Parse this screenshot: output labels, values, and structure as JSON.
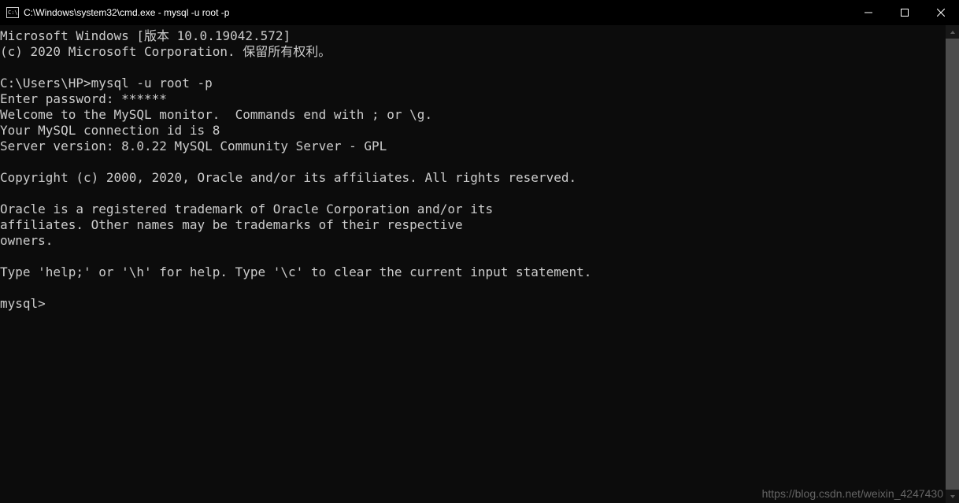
{
  "titlebar": {
    "title": "C:\\Windows\\system32\\cmd.exe - mysql  -u root -p"
  },
  "terminal": {
    "lines": [
      "Microsoft Windows [版本 10.0.19042.572]",
      "(c) 2020 Microsoft Corporation. 保留所有权利。",
      "",
      "C:\\Users\\HP>mysql -u root -p",
      "Enter password: ******",
      "Welcome to the MySQL monitor.  Commands end with ; or \\g.",
      "Your MySQL connection id is 8",
      "Server version: 8.0.22 MySQL Community Server - GPL",
      "",
      "Copyright (c) 2000, 2020, Oracle and/or its affiliates. All rights reserved.",
      "",
      "Oracle is a registered trademark of Oracle Corporation and/or its",
      "affiliates. Other names may be trademarks of their respective",
      "owners.",
      "",
      "Type 'help;' or '\\h' for help. Type '\\c' to clear the current input statement.",
      "",
      "mysql>"
    ]
  },
  "watermark": {
    "text": "https://blog.csdn.net/weixin_4247430"
  }
}
